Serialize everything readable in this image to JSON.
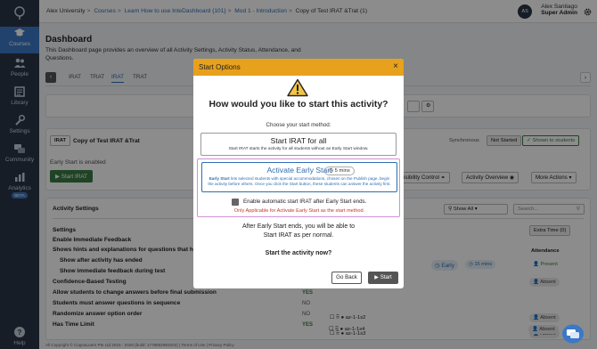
{
  "nav": {
    "items": [
      {
        "label": "Courses",
        "icon": "graduation-cap-icon"
      },
      {
        "label": "People",
        "icon": "people-icon"
      },
      {
        "label": "Library",
        "icon": "library-icon"
      },
      {
        "label": "Settings",
        "icon": "wrench-icon"
      },
      {
        "label": "Community",
        "icon": "chat-bubbles-icon"
      },
      {
        "label": "Analytics",
        "icon": "bar-chart-icon"
      },
      {
        "label": "Help",
        "icon": "help-icon"
      }
    ],
    "beta": "BETA"
  },
  "breadcrumb": {
    "items": [
      "Alex University",
      "Courses",
      "Learn How to use InteDashboard {101}",
      "Mod 1 - Introduction",
      "Copy of Test IRAT &Trat (1)"
    ]
  },
  "user": {
    "initials": "AS",
    "name": "Alex Santiago",
    "role": "Super Admin"
  },
  "dashboard": {
    "title": "Dashboard",
    "description": "This Dashboard page provides an overview of all Activity Settings, Activity Status, Attendance, and Questions."
  },
  "tabs": [
    "IRAT",
    "TRAT",
    "IRAT",
    "TRAT"
  ],
  "activity": {
    "badge": "IRAT",
    "name": "Copy of Test IRAT &Trat",
    "mode": "Synchronous",
    "status": "Not Started",
    "shown": "Shown to students",
    "early_start": "Early Start is enabled",
    "start_button": "Start IRAT",
    "visibility": "isibility Control",
    "overview": "Activity Overview",
    "more": "More Actions"
  },
  "settings": {
    "title": "Activity Settings",
    "show_all": "Show All",
    "search_placeholder": "Search...",
    "heading": "Settings",
    "rows": [
      {
        "label": "Enable Immediate Feedback",
        "value": ""
      },
      {
        "label": "Shows hints and explanations for questions that have",
        "value": ""
      },
      {
        "label": "Show after activity has ended",
        "value": ""
      },
      {
        "label": "Show immediate feedback during test",
        "value": ""
      },
      {
        "label": "Confidence-Based Testing",
        "value": ""
      },
      {
        "label": "Allow students to change answers before final submission",
        "value": "YES"
      },
      {
        "label": "Students must answer questions in sequence",
        "value": "NO"
      },
      {
        "label": "Randomize answer option order",
        "value": "NO"
      },
      {
        "label": "Has Time Limit",
        "value": "YES"
      }
    ]
  },
  "attendance": {
    "extra_time": "Extra Time (0)",
    "header": "Attendance",
    "early": "Early",
    "mins": "15 mins",
    "present": "Present",
    "students": [
      {
        "name": "az-1-1s2",
        "status": "Absent"
      },
      {
        "name": "az-1-1s3",
        "status": "Absent"
      },
      {
        "name": "az-1-1s4",
        "status": "Absent"
      }
    ],
    "first_status": "Absent"
  },
  "footer": "All Copyright © CognaLearn Pte Ltd 2015 - 2026 (build: 1778852983202) | Terms of Use | Privacy Policy",
  "modal": {
    "title": "Start Options",
    "close": "×",
    "question": "How would you like to start this activity?",
    "choose": "Choose your start method:",
    "option1_title": "Start IRAT for all",
    "option1_desc": "Start IRAT starts the activity for all students without an Early Start window.",
    "option2_title": "Activate Early Start",
    "option2_mins": "5 mins",
    "option2_desc_bold": "Early Start",
    "option2_desc": " lets selected students with special accommodations, chosen on the Publish page, begin the activity before others. Once you click the Start button, these students can answer the activity first.",
    "checkbox_label": "Enable automatic start IRAT after Early Start ends.",
    "only_note": "Only Applicable for Activate Early Start as the start method.",
    "after_line1": "After Early Start ends, you will be able to",
    "after_line2": "Start IRAT as per normal.",
    "start_question": "Start the activity now?",
    "go_back": "Go Back",
    "start": "Start"
  },
  "colors": {
    "nav_bg": "#2b3648",
    "accent": "#3b78c7",
    "modal_header": "#e8a11c",
    "green": "#3a7d44"
  }
}
